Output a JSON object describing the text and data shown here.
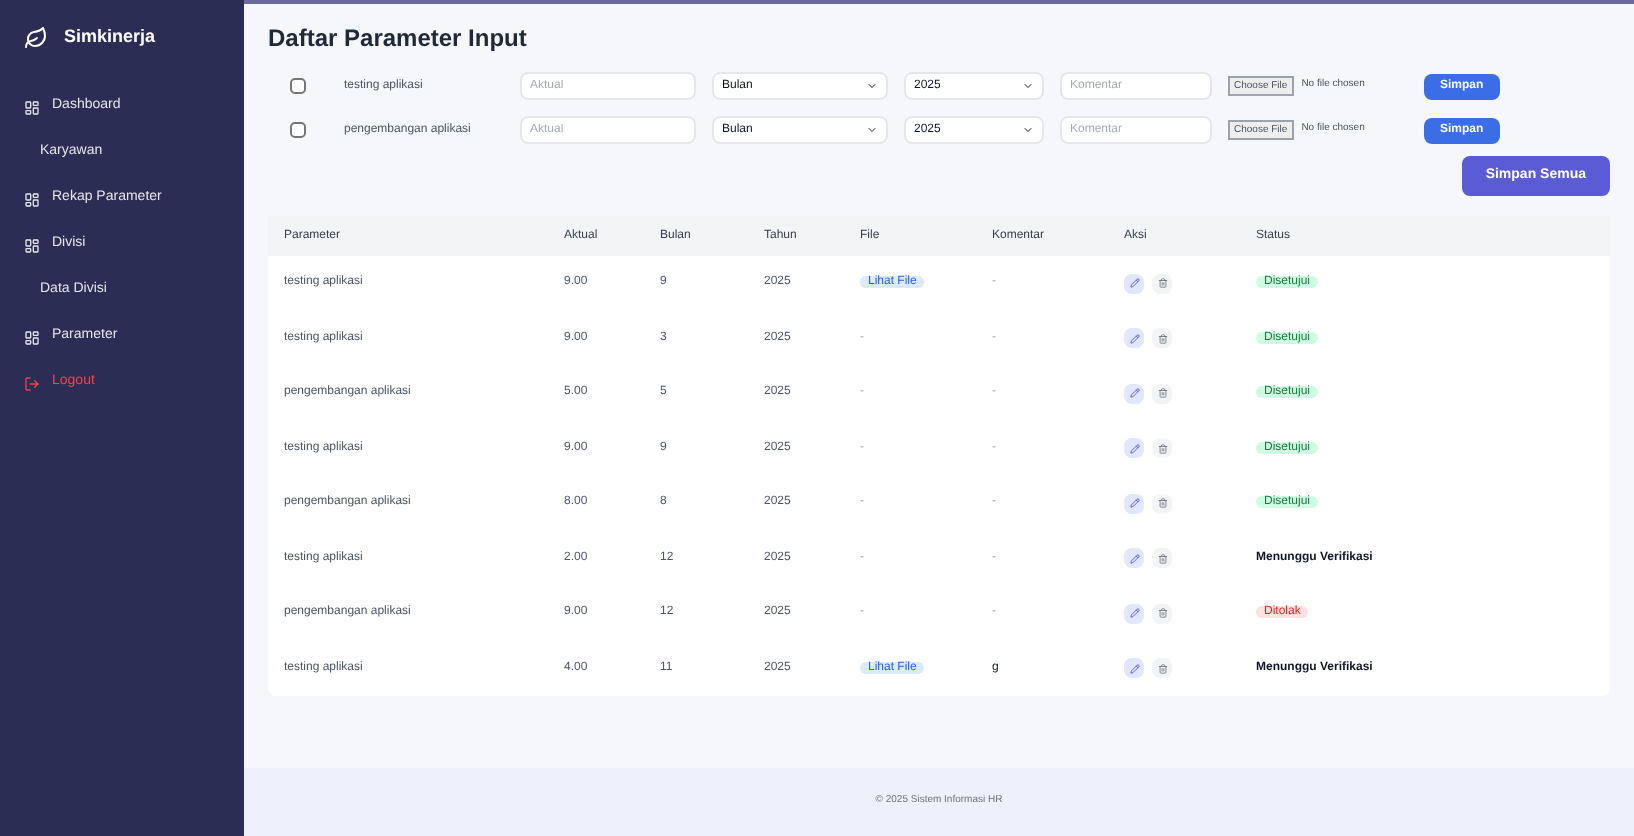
{
  "sidebar": {
    "brand": "Simkinerja",
    "items": [
      {
        "label": "Dashboard",
        "kind": "main",
        "selected": false
      },
      {
        "label": "Karyawan",
        "kind": "sub",
        "selected": false
      },
      {
        "label": "Rekap Parameter",
        "kind": "main",
        "selected": false
      },
      {
        "label": "Divisi",
        "kind": "main",
        "selected": false
      },
      {
        "label": "Data Divisi",
        "kind": "sub",
        "selected": false
      },
      {
        "label": "Parameter",
        "kind": "main",
        "selected": false
      },
      {
        "label": "Logout",
        "kind": "danger",
        "selected": false
      }
    ]
  },
  "page_title": "Daftar Parameter Input",
  "input_rows": [
    {
      "checked": false,
      "parameter": "testing aplikasi",
      "actual_placeholder": "Aktual",
      "month": "Bulan",
      "year": "2025",
      "comment_placeholder": "Komentar",
      "file_button": "Choose File",
      "file_status": "No file chosen",
      "save": "Simpan"
    },
    {
      "checked": false,
      "parameter": "pengembangan aplikasi",
      "actual_placeholder": "Aktual",
      "month": "Bulan",
      "year": "2025",
      "comment_placeholder": "Komentar",
      "file_button": "Choose File",
      "file_status": "No file chosen",
      "save": "Simpan"
    }
  ],
  "save_all": "Simpan Semua",
  "table": {
    "columns": [
      "Parameter",
      "Aktual",
      "Bulan",
      "Tahun",
      "File",
      "Komentar",
      "Aksi",
      "Status"
    ],
    "rows": [
      {
        "parameter": "testing aplikasi",
        "actual": "9.00",
        "month": "9",
        "year": "2025",
        "file": "Lihat File",
        "comment": "-",
        "status": "Disetujui",
        "kind": "approved"
      },
      {
        "parameter": "testing aplikasi",
        "actual": "9.00",
        "month": "3",
        "year": "2025",
        "file": "-",
        "comment": "-",
        "status": "Disetujui",
        "kind": "approved"
      },
      {
        "parameter": "pengembangan aplikasi",
        "actual": "5.00",
        "month": "5",
        "year": "2025",
        "file": "-",
        "comment": "-",
        "status": "Disetujui",
        "kind": "approved"
      },
      {
        "parameter": "testing aplikasi",
        "actual": "9.00",
        "month": "9",
        "year": "2025",
        "file": "-",
        "comment": "-",
        "status": "Disetujui",
        "kind": "approved"
      },
      {
        "parameter": "pengembangan aplikasi",
        "actual": "8.00",
        "month": "8",
        "year": "2025",
        "file": "-",
        "comment": "-",
        "status": "Disetujui",
        "kind": "approved"
      },
      {
        "parameter": "testing aplikasi",
        "actual": "2.00",
        "month": "12",
        "year": "2025",
        "file": "-",
        "comment": "-",
        "status": "Menunggu Verifikasi",
        "kind": "pending"
      },
      {
        "parameter": "pengembangan aplikasi",
        "actual": "9.00",
        "month": "12",
        "year": "2025",
        "file": "-",
        "comment": "-",
        "status": "Ditolak",
        "kind": "rejected"
      },
      {
        "parameter": "testing aplikasi",
        "actual": "4.00",
        "month": "11",
        "year": "2025",
        "file": "Lihat File",
        "comment": "g",
        "status": "Menunggu Verifikasi",
        "kind": "pending"
      }
    ]
  },
  "footer": "© 2025 Sistem Informasi HR"
}
